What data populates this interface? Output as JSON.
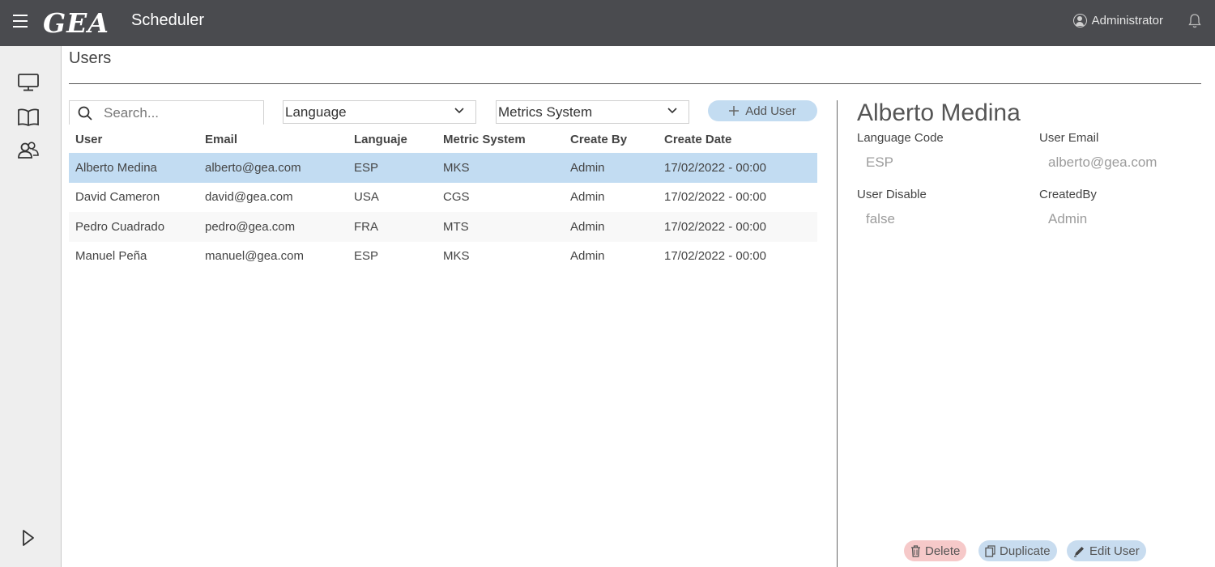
{
  "header": {
    "logo": "GEA",
    "app_title": "Scheduler",
    "user_name": "Administrator"
  },
  "sidebar": {
    "items": [
      {
        "icon": "monitor-icon"
      },
      {
        "icon": "book-icon"
      },
      {
        "icon": "users-icon"
      }
    ],
    "bottom_icon": "play-icon"
  },
  "page": {
    "title": "Users"
  },
  "toolbar": {
    "search_placeholder": "Search...",
    "language_select": "Language",
    "metrics_select": "Metrics System",
    "add_user_label": "Add User"
  },
  "table": {
    "columns": [
      "User",
      "Email",
      "Languaje",
      "Metric System",
      "Create By",
      "Create Date"
    ],
    "rows": [
      {
        "user": "Alberto Medina",
        "email": "alberto@gea.com",
        "language": "ESP",
        "metric": "MKS",
        "created_by": "Admin",
        "created_date": "17/02/2022 - 00:00",
        "selected": true
      },
      {
        "user": "David Cameron",
        "email": "david@gea.com",
        "language": "USA",
        "metric": "CGS",
        "created_by": "Admin",
        "created_date": "17/02/2022 - 00:00"
      },
      {
        "user": "Pedro Cuadrado",
        "email": "pedro@gea.com",
        "language": "FRA",
        "metric": "MTS",
        "created_by": "Admin",
        "created_date": "17/02/2022 - 00:00"
      },
      {
        "user": "Manuel Peña",
        "email": "manuel@gea.com",
        "language": "ESP",
        "metric": "MKS",
        "created_by": "Admin",
        "created_date": "17/02/2022 - 00:00"
      }
    ]
  },
  "detail": {
    "name": "Alberto Medina",
    "language_code_label": "Language Code",
    "language_code_value": "ESP",
    "user_email_label": "User Email",
    "user_email_value": "alberto@gea.com",
    "user_disable_label": "User Disable",
    "user_disable_value": "false",
    "created_by_label": "CreatedBy",
    "created_by_value": "Admin",
    "delete_label": "Delete",
    "duplicate_label": "Duplicate",
    "edit_label": "Edit User"
  },
  "colors": {
    "topbar": "#4a4b4f",
    "selected_row": "#c2dcf2",
    "primary_button": "#c3dcf1",
    "delete_button": "#f6c9c9"
  }
}
